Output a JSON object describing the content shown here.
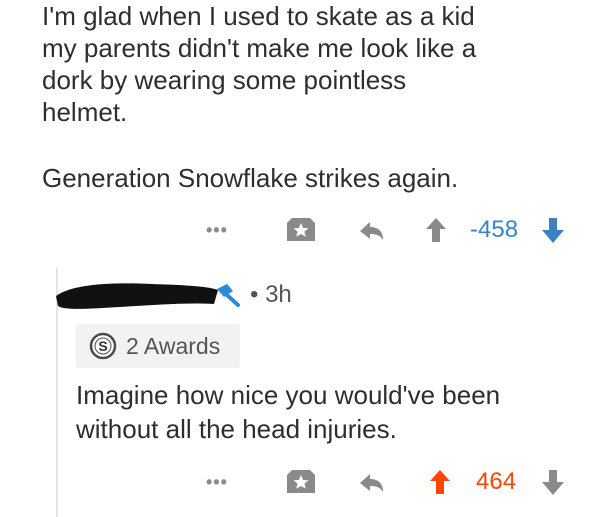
{
  "parent_comment": {
    "lines": [
      "I'm glad when I used to skate as a kid",
      "my parents didn't make me look like a",
      "dork by wearing some pointless",
      "helmet."
    ],
    "second_paragraph": "Generation Snowflake strikes again.",
    "actions": {
      "more": "•••",
      "score": "-458"
    }
  },
  "reply_comment": {
    "time_ago": "• 3h",
    "awards_label": "2 Awards",
    "award_icon": "silver-award-icon",
    "lines": [
      "Imagine how nice you would've been",
      "without all the head injuries."
    ],
    "actions": {
      "more": "•••",
      "score": "464"
    }
  },
  "colors": {
    "upvote_active": "#ff4500",
    "score_neutral": "#3b82c4",
    "icon_gray": "#8a8a8a",
    "mod_blue": "#2b8ad8"
  }
}
